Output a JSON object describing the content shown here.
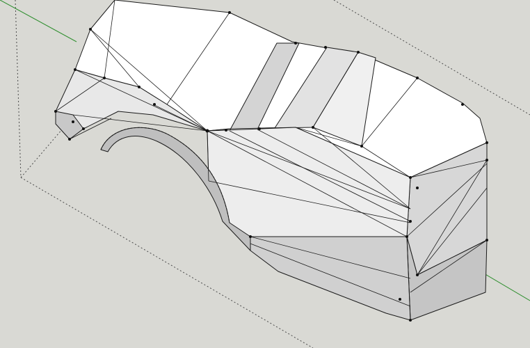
{
  "viewport": {
    "background": "#d9d9d4",
    "axis_green": "#2f8f2f",
    "edge_color": "#1a1a1a",
    "guide_color": "#4a4a4a",
    "face_light": "#ffffff",
    "face_mid": "#e6e6e6",
    "face_dark": "#c9c9c9"
  }
}
